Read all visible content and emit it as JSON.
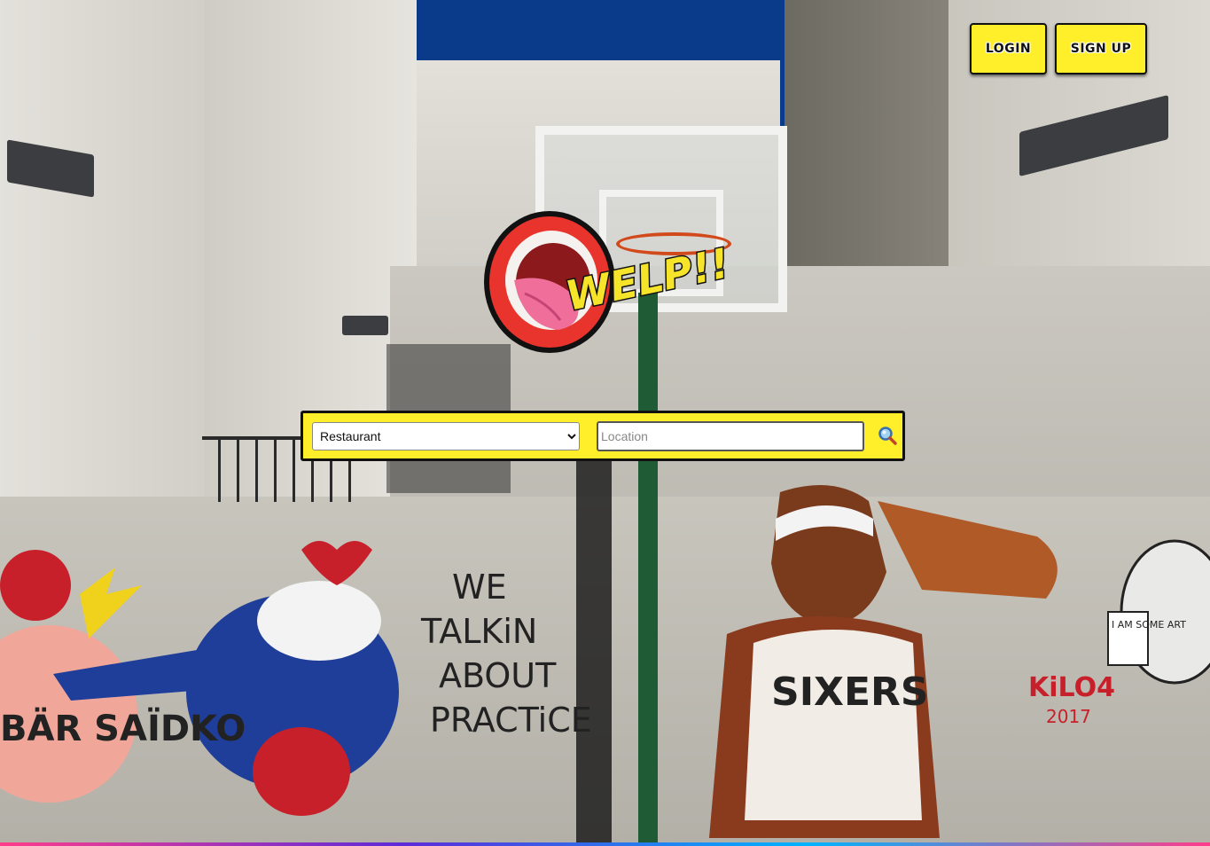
{
  "header": {
    "login_label": "LOGIN",
    "signup_label": "SIGN UP"
  },
  "logo": {
    "text": "WELP!!"
  },
  "search": {
    "category_selected": "Restaurant",
    "category_options": [
      "Restaurant"
    ],
    "location_placeholder": "Location",
    "location_value": ""
  },
  "background": {
    "graffiti_wall_text": [
      "WE",
      "TALKiN",
      "ABOUT",
      "PRACTiCE"
    ],
    "graffiti_left_text": "BÄR SAÏDKO",
    "graffiti_jersey_text": "SIXERS",
    "graffiti_tag_text": "KiLO4",
    "graffiti_tag_year": "2017",
    "graffiti_bubble_text": "I AM SOME ART"
  },
  "colors": {
    "accent_yellow": "#ffef2a",
    "border_dark": "#111111",
    "sky_blue": "#0a3a8a"
  },
  "icons": {
    "search": "magnifier-icon"
  }
}
